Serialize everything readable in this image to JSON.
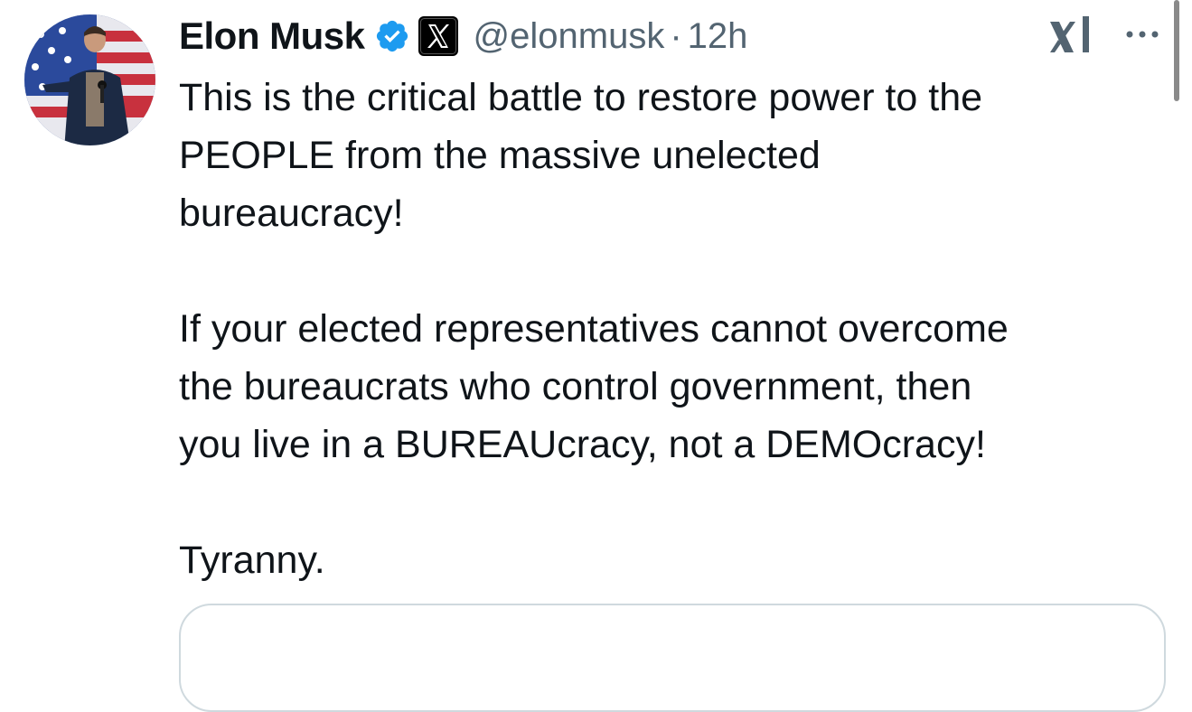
{
  "author": {
    "display_name": "Elon Musk",
    "handle": "@elonmusk",
    "separator": "·",
    "timestamp": "12h",
    "verified_badge": "verified-badge-icon",
    "affiliation_badge": "x-logo-icon"
  },
  "tweet": {
    "paragraphs": [
      "This is the critical battle to restore power to the\nPEOPLE from the massive unelected\nbureaucracy!",
      "If your elected representatives cannot overcome\nthe bureaucrats who control government, then\nyou live in a BUREAUcracy, not a DEMOcracy!",
      "Tyranny."
    ]
  },
  "actions": {
    "grok_icon": "grok-icon",
    "more_icon": "more-dots-icon"
  },
  "colors": {
    "text": "#0f1419",
    "secondary": "#536471",
    "verified_blue": "#1d9bf0",
    "border": "#cfd9de"
  }
}
